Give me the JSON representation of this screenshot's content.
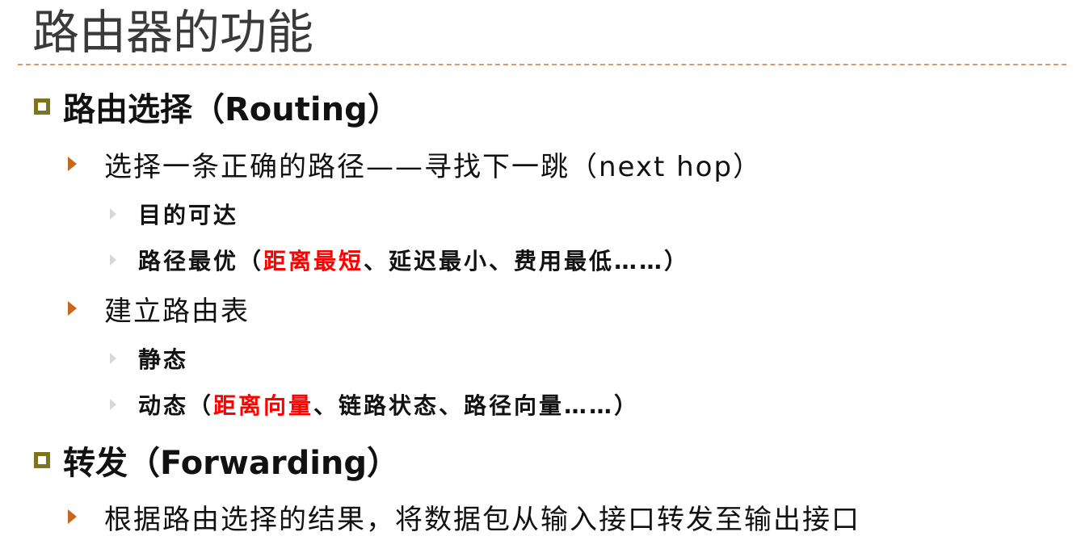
{
  "title": "路由器的功能",
  "sections": [
    {
      "heading": "路由选择（Routing）",
      "items": [
        {
          "text": "选择一条正确的路径——寻找下一跳（next hop）",
          "subitems": [
            {
              "text": "目的可达"
            },
            {
              "prefix": "路径最优（",
              "highlight": "距离最短",
              "suffix": "、延迟最小、费用最低……）"
            }
          ]
        },
        {
          "text": "建立路由表",
          "subitems": [
            {
              "text": "静态"
            },
            {
              "prefix": "动态（",
              "highlight": "距离向量",
              "suffix": "、链路状态、路径向量……）"
            }
          ]
        }
      ]
    },
    {
      "heading": "转发（Forwarding）",
      "items": [
        {
          "text": "根据路由选择的结果，将数据包从输入接口转发至输出接口"
        }
      ]
    }
  ],
  "colors": {
    "title": "#3a3a3a",
    "rule": "#d79a6a",
    "level1_bullet": "#7d7420",
    "level2_bullet": "#c8661e",
    "level3_bullet": "#d8d8d8",
    "highlight": "#ff0000"
  }
}
